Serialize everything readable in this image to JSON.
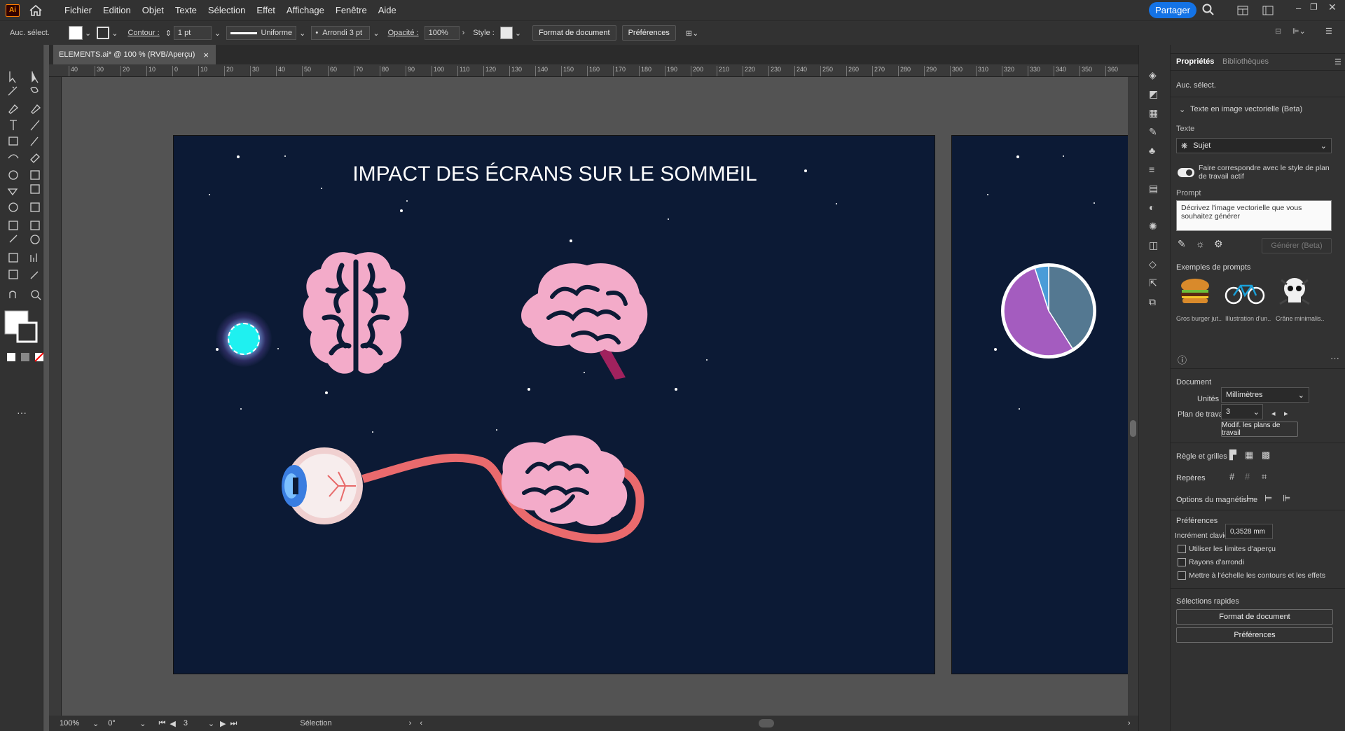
{
  "app": {
    "logo": "Ai"
  },
  "menu": [
    "Fichier",
    "Edition",
    "Objet",
    "Texte",
    "Sélection",
    "Effet",
    "Affichage",
    "Fenêtre",
    "Aide"
  ],
  "topright": {
    "share": "Partager"
  },
  "control": {
    "selection": "Auc. sélect.",
    "stroke_label": "Contour :",
    "stroke_value": "1 pt",
    "profile": "Uniforme",
    "brush": "Arrondi 3 pt",
    "opacity_label": "Opacité :",
    "opacity_value": "100%",
    "style_label": "Style :",
    "doc_format": "Format de document",
    "prefs": "Préférences"
  },
  "doc_tab": {
    "title": "ELEMENTS.ai* @ 100 % (RVB/Aperçu)",
    "close": "×"
  },
  "ruler_ticks": [
    "40",
    "30",
    "20",
    "10",
    "0",
    "10",
    "20",
    "30",
    "40",
    "50",
    "60",
    "70",
    "80",
    "90",
    "100",
    "110",
    "120",
    "130",
    "140",
    "150",
    "160",
    "170",
    "180",
    "190",
    "200",
    "210",
    "220",
    "230",
    "240",
    "250",
    "260",
    "270",
    "280",
    "290",
    "300",
    "310",
    "320",
    "330",
    "340",
    "350",
    "360"
  ],
  "artboard": {
    "title": "IMPACT DES ÉCRANS SUR LE SOMMEIL",
    "bg": "#0c1a35",
    "brain": "#f3abc9",
    "brain_line": "#0c1a35",
    "nerve": "#ea6a6d",
    "glow": "#1ff0f0"
  },
  "pie": {
    "values": [
      0.41,
      0.54,
      0.05
    ],
    "colors": [
      "#547891",
      "#a45cbf",
      "#4a9cd8"
    ]
  },
  "status": {
    "zoom": "100%",
    "angle": "0°",
    "artboard_num": "3",
    "tool": "Sélection"
  },
  "panel": {
    "tabs": [
      "Propriétés",
      "Bibliothèques"
    ],
    "no_selection": "Auc. sélect.",
    "section_title": "Texte en image vectorielle (Beta)",
    "text_label": "Texte",
    "type_value": "Sujet",
    "match_style": "Faire correspondre avec le style de plan de travail actif",
    "prompt_label": "Prompt",
    "prompt_placeholder": "Décrivez l'image vectorielle que vous souhaitez générer",
    "generate": "Générer (Beta)",
    "examples_label": "Exemples de prompts",
    "examples": [
      "Gros burger jut...",
      "Illustration d'un...",
      "Crâne minimalis..."
    ],
    "document_label": "Document",
    "units_label": "Unités :",
    "units_value": "Millimètres",
    "artboard_label": "Plan de travail :",
    "artboard_value": "3",
    "edit_artboards": "Modif. les plans de travail",
    "rulers_label": "Règle et grilles",
    "guides_label": "Repères",
    "snap_label": "Options du magnétisme",
    "prefs_label": "Préférences",
    "keyboard_label": "Incrément clavier :",
    "keyboard_value": "0,3528 mm",
    "check1": "Utiliser les limites d'aperçu",
    "check2": "Rayons d'arrondi",
    "check3": "Mettre à l'échelle les contours et les effets",
    "quick_label": "Sélections rapides",
    "quick_btn1": "Format de document",
    "quick_btn2": "Préférences"
  }
}
